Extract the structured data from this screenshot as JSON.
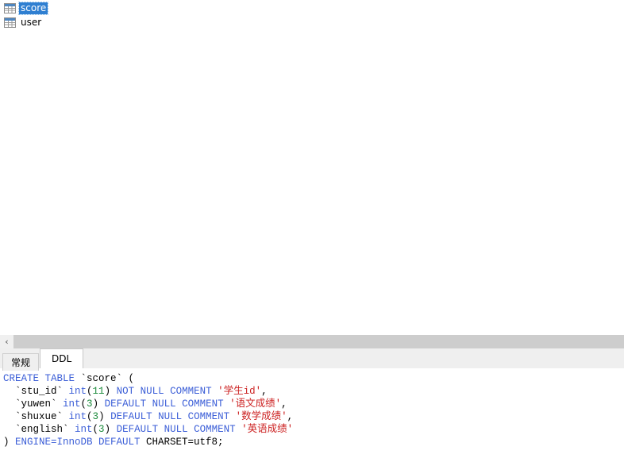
{
  "tree": {
    "items": [
      {
        "label": "score",
        "icon": "table-icon",
        "selected": true
      },
      {
        "label": "user",
        "icon": "table-icon",
        "selected": false
      }
    ]
  },
  "scrollbar": {
    "left_arrow_glyph": "‹"
  },
  "tabs": {
    "items": [
      {
        "label": "常规",
        "active": false
      },
      {
        "label": "DDL",
        "active": true
      }
    ]
  },
  "ddl": {
    "lines": [
      [
        {
          "t": "CREATE TABLE ",
          "c": "tok-kw"
        },
        {
          "t": "`score` (",
          "c": "tok-ident"
        }
      ],
      [
        {
          "t": "  `stu_id` ",
          "c": "tok-ident"
        },
        {
          "t": "int",
          "c": "tok-type"
        },
        {
          "t": "(",
          "c": "tok-plain"
        },
        {
          "t": "11",
          "c": "tok-num"
        },
        {
          "t": ") ",
          "c": "tok-plain"
        },
        {
          "t": "NOT NULL COMMENT ",
          "c": "tok-kw"
        },
        {
          "t": "'学生id'",
          "c": "tok-str"
        },
        {
          "t": ",",
          "c": "tok-plain"
        }
      ],
      [
        {
          "t": "  `yuwen` ",
          "c": "tok-ident"
        },
        {
          "t": "int",
          "c": "tok-type"
        },
        {
          "t": "(",
          "c": "tok-plain"
        },
        {
          "t": "3",
          "c": "tok-num"
        },
        {
          "t": ") ",
          "c": "tok-plain"
        },
        {
          "t": "DEFAULT NULL COMMENT ",
          "c": "tok-kw"
        },
        {
          "t": "'语文成绩'",
          "c": "tok-str"
        },
        {
          "t": ",",
          "c": "tok-plain"
        }
      ],
      [
        {
          "t": "  `shuxue` ",
          "c": "tok-ident"
        },
        {
          "t": "int",
          "c": "tok-type"
        },
        {
          "t": "(",
          "c": "tok-plain"
        },
        {
          "t": "3",
          "c": "tok-num"
        },
        {
          "t": ") ",
          "c": "tok-plain"
        },
        {
          "t": "DEFAULT NULL COMMENT ",
          "c": "tok-kw"
        },
        {
          "t": "'数学成绩'",
          "c": "tok-str"
        },
        {
          "t": ",",
          "c": "tok-plain"
        }
      ],
      [
        {
          "t": "  `english` ",
          "c": "tok-ident"
        },
        {
          "t": "int",
          "c": "tok-type"
        },
        {
          "t": "(",
          "c": "tok-plain"
        },
        {
          "t": "3",
          "c": "tok-num"
        },
        {
          "t": ") ",
          "c": "tok-plain"
        },
        {
          "t": "DEFAULT NULL COMMENT ",
          "c": "tok-kw"
        },
        {
          "t": "'英语成绩'",
          "c": "tok-str"
        }
      ],
      [
        {
          "t": ") ",
          "c": "tok-plain"
        },
        {
          "t": "ENGINE=InnoDB DEFAULT ",
          "c": "tok-kw"
        },
        {
          "t": "CHARSET=utf8;",
          "c": "tok-plain"
        }
      ]
    ]
  },
  "colors": {
    "selection_blue": "#2f7fd1",
    "keyword_blue": "#3b5ed7",
    "string_red": "#cc2222",
    "number_green": "#1a8a3a",
    "scrollbar_track": "#cdcdcd",
    "tabstrip_bg": "#efefef"
  }
}
